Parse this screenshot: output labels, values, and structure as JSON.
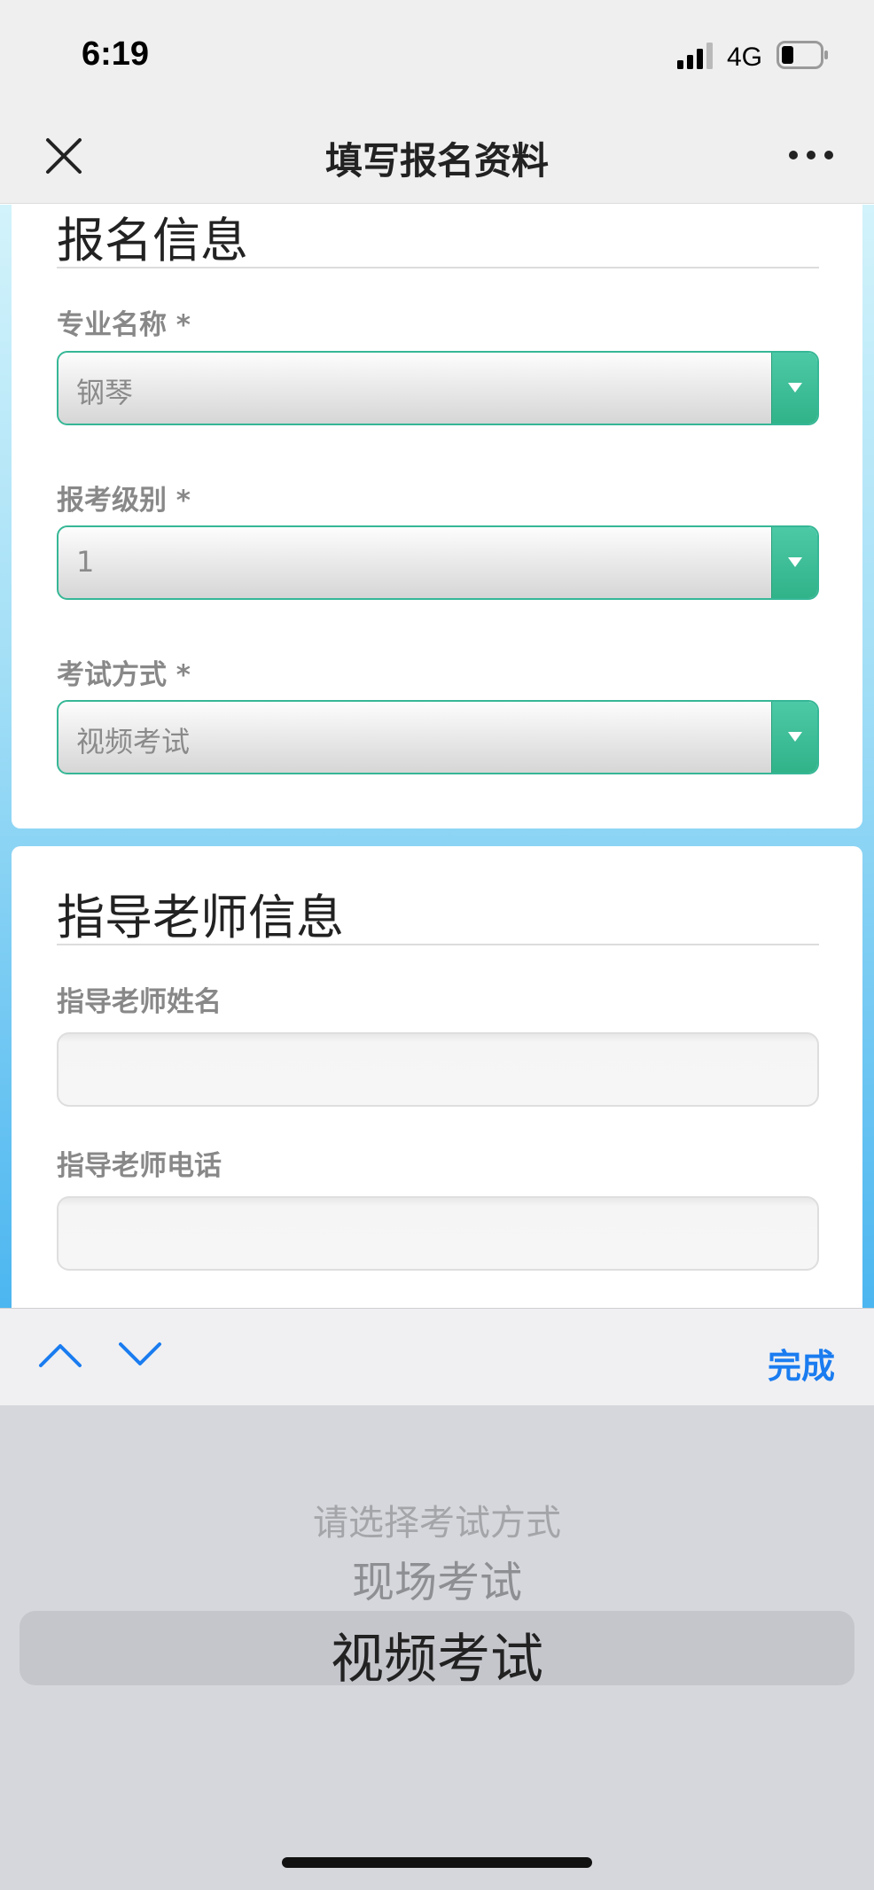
{
  "status_bar": {
    "time": "6:19",
    "network": "4G"
  },
  "nav": {
    "title": "填写报名资料",
    "close_icon": "close-icon",
    "more_icon": "more-horizontal-icon"
  },
  "registration_section": {
    "title": "报名信息",
    "fields": [
      {
        "label": "专业名称 *",
        "value": "钢琴"
      },
      {
        "label": "报考级别 *",
        "value": "1"
      },
      {
        "label": "考试方式 *",
        "value": "视频考试"
      }
    ]
  },
  "teacher_section": {
    "title": "指导老师信息",
    "name_label": "指导老师姓名",
    "name_value": "",
    "phone_label": "指导老师电话",
    "phone_value": ""
  },
  "accessory": {
    "prev_icon": "chevron-up-icon",
    "next_icon": "chevron-down-icon",
    "done_label": "完成"
  },
  "picker": {
    "options": [
      "请选择考试方式",
      "现场考试",
      "视频考试"
    ],
    "selected": "视频考试"
  },
  "colors": {
    "accent_green": "#36b796",
    "done_blue": "#1a7cf0"
  }
}
